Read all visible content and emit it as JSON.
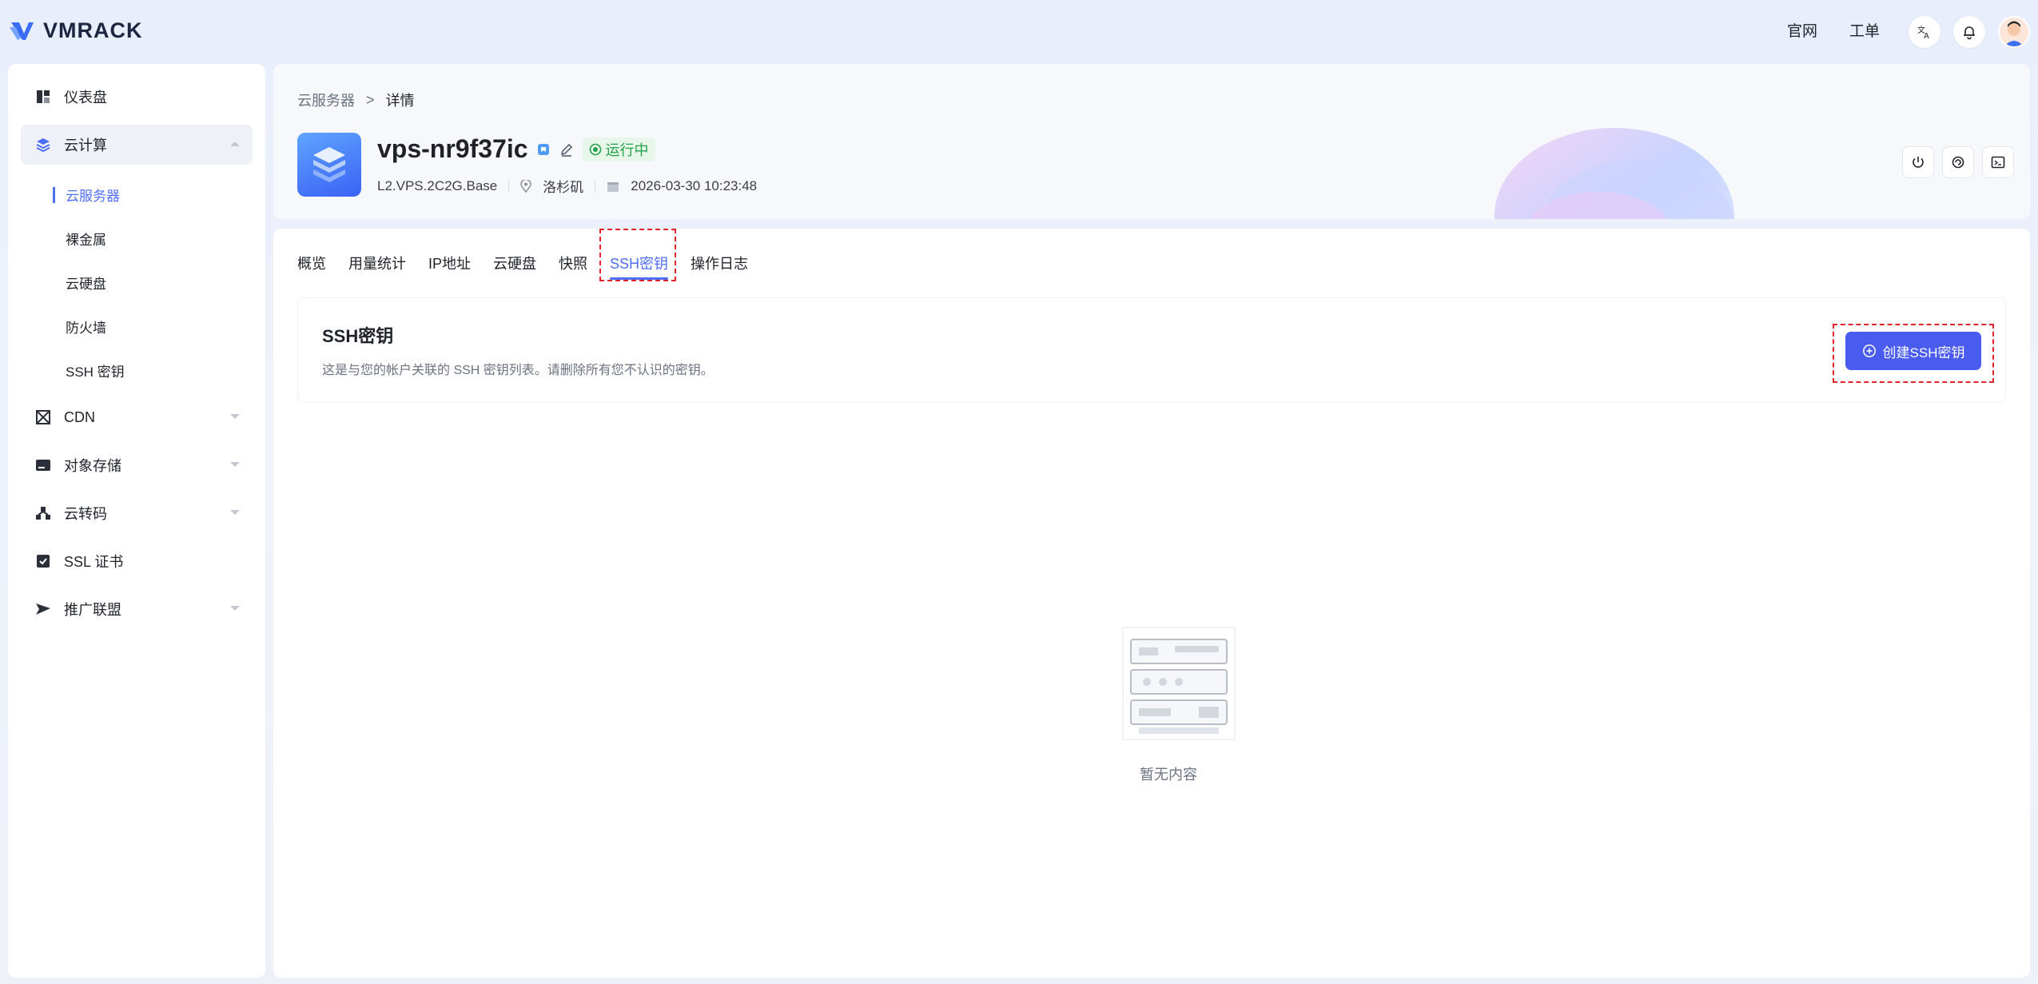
{
  "brand": {
    "name": "VMRACK"
  },
  "topbar": {
    "links": [
      "官网",
      "工单"
    ]
  },
  "sidebar": {
    "items": [
      {
        "label": "仪表盘"
      },
      {
        "label": "云计算",
        "children": [
          "云服务器",
          "裸金属",
          "云硬盘",
          "防火墙",
          "SSH 密钥"
        ]
      },
      {
        "label": "CDN"
      },
      {
        "label": "对象存储"
      },
      {
        "label": "云转码"
      },
      {
        "label": "SSL 证书"
      },
      {
        "label": "推广联盟"
      }
    ]
  },
  "breadcrumb": {
    "parent": "云服务器",
    "sep": ">",
    "current": "详情"
  },
  "vps": {
    "name": "vps-nr9f37ic",
    "status": "运行中",
    "plan": "L2.VPS.2C2G.Base",
    "location": "洛杉矶",
    "created": "2026-03-30 10:23:48"
  },
  "tabs": [
    "概览",
    "用量统计",
    "IP地址",
    "云硬盘",
    "快照",
    "SSH密钥",
    "操作日志"
  ],
  "panel": {
    "title": "SSH密钥",
    "description": "这是与您的帐户关联的 SSH 密钥列表。请删除所有您不认识的密钥。",
    "create_label": "创建SSH密钥"
  },
  "empty": {
    "text": "暂无内容"
  },
  "colors": {
    "accent": "#4f6ef7",
    "button": "#4a5cf0",
    "status": "#23a34a",
    "highlight": "#e0242a"
  }
}
